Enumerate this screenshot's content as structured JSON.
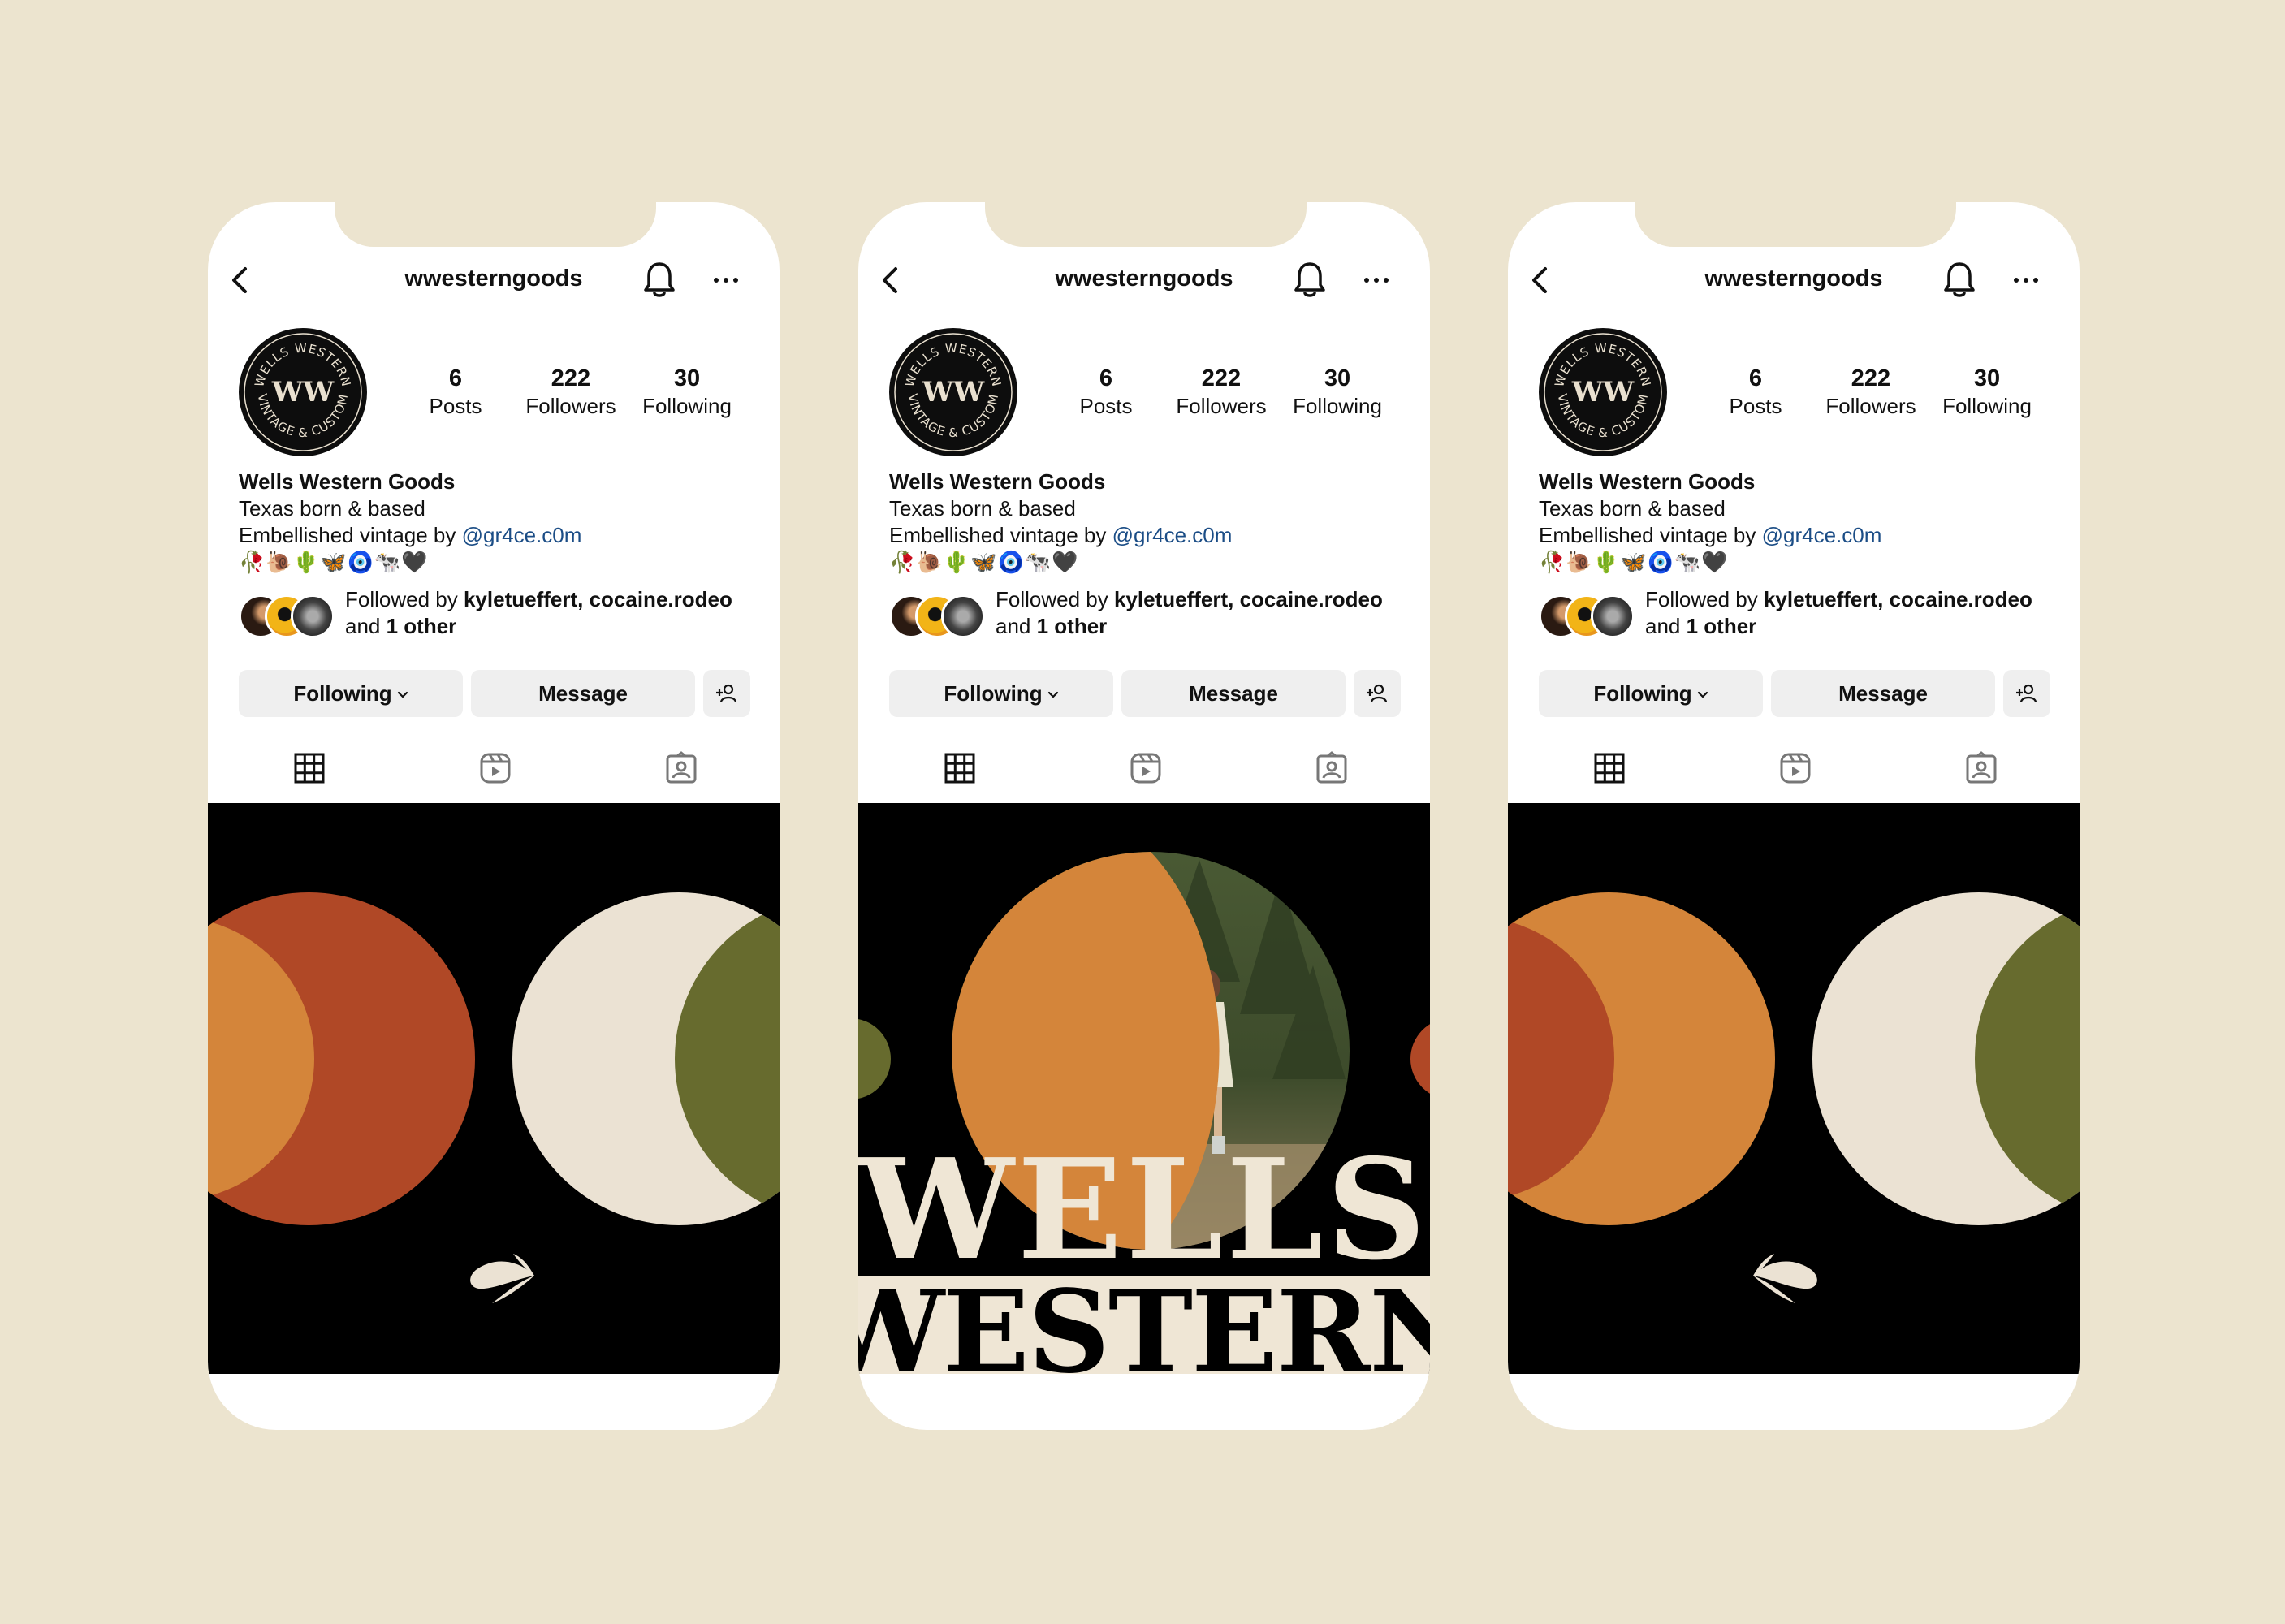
{
  "profiles": [
    {
      "username": "wwesterngoods",
      "stats": {
        "posts_count": "6",
        "posts_label": "Posts",
        "followers_count": "222",
        "followers_label": "Followers",
        "following_count": "30",
        "following_label": "Following"
      },
      "bio": {
        "name": "Wells Western Goods",
        "line1": "Texas born & based",
        "line2_prefix": "Embellished vintage by ",
        "line2_mention": "@gr4ce.c0m",
        "emoji": "🥀🐌🌵🦋🧿🐄🖤"
      },
      "followed_by": {
        "prefix": "Followed by ",
        "users": "kyletueffert, cocaine.rodeo",
        "and": "and ",
        "other": "1 other"
      },
      "buttons": {
        "following": "Following",
        "message": "Message"
      },
      "logo": {
        "top": "WELLS WESTERN",
        "bottom": "VINTAGE & CUSTOM",
        "mono": "WW"
      }
    },
    {
      "username": "wwesterngoods",
      "stats": {
        "posts_count": "6",
        "posts_label": "Posts",
        "followers_count": "222",
        "followers_label": "Followers",
        "following_count": "30",
        "following_label": "Following"
      },
      "bio": {
        "name": "Wells Western Goods",
        "line1": "Texas born & based",
        "line2_prefix": "Embellished vintage by ",
        "line2_mention": "@gr4ce.c0m",
        "emoji": "🥀🐌🌵🦋🧿🐄🖤"
      },
      "followed_by": {
        "prefix": "Followed by ",
        "users": "kyletueffert, cocaine.rodeo",
        "and": "and ",
        "other": "1 other"
      },
      "buttons": {
        "following": "Following",
        "message": "Message"
      },
      "logo": {
        "top": "WELLS WESTERN",
        "bottom": "VINTAGE & CUSTOM",
        "mono": "WW"
      },
      "post_wordmark": {
        "line1": "WELLS",
        "line2": "WESTERN"
      }
    },
    {
      "username": "wwesterngoods",
      "stats": {
        "posts_count": "6",
        "posts_label": "Posts",
        "followers_count": "222",
        "followers_label": "Followers",
        "following_count": "30",
        "following_label": "Following"
      },
      "bio": {
        "name": "Wells Western Goods",
        "line1": "Texas born & based",
        "line2_prefix": "Embellished vintage by ",
        "line2_mention": "@gr4ce.c0m",
        "emoji": "🥀🐌🌵🦋🧿🐄🖤"
      },
      "followed_by": {
        "prefix": "Followed by ",
        "users": "kyletueffert, cocaine.rodeo",
        "and": "and ",
        "other": "1 other"
      },
      "buttons": {
        "following": "Following",
        "message": "Message"
      },
      "logo": {
        "top": "WELLS WESTERN",
        "bottom": "VINTAGE & CUSTOM",
        "mono": "WW"
      }
    }
  ],
  "icons": [
    "back-arrow-icon",
    "bell-icon",
    "more-icon",
    "grid-icon",
    "reels-icon",
    "tagged-icon",
    "add-person-icon",
    "chevron-down-icon",
    "drop-ornament-icon"
  ],
  "colors": {
    "background": "#ece4cf",
    "post_bg": "#000000",
    "orange": "#d4853a",
    "rust": "#b04826",
    "cream": "#ebe2d3",
    "olive": "#676b2e",
    "mention": "#1b4d86"
  }
}
